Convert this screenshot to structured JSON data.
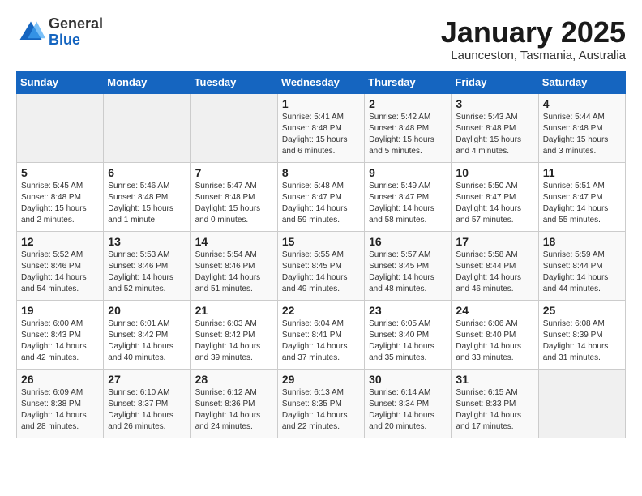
{
  "header": {
    "logo_general": "General",
    "logo_blue": "Blue",
    "month": "January 2025",
    "location": "Launceston, Tasmania, Australia"
  },
  "weekdays": [
    "Sunday",
    "Monday",
    "Tuesday",
    "Wednesday",
    "Thursday",
    "Friday",
    "Saturday"
  ],
  "weeks": [
    [
      {
        "day": "",
        "sunrise": "",
        "sunset": "",
        "daylight": ""
      },
      {
        "day": "",
        "sunrise": "",
        "sunset": "",
        "daylight": ""
      },
      {
        "day": "",
        "sunrise": "",
        "sunset": "",
        "daylight": ""
      },
      {
        "day": "1",
        "sunrise": "Sunrise: 5:41 AM",
        "sunset": "Sunset: 8:48 PM",
        "daylight": "Daylight: 15 hours and 6 minutes."
      },
      {
        "day": "2",
        "sunrise": "Sunrise: 5:42 AM",
        "sunset": "Sunset: 8:48 PM",
        "daylight": "Daylight: 15 hours and 5 minutes."
      },
      {
        "day": "3",
        "sunrise": "Sunrise: 5:43 AM",
        "sunset": "Sunset: 8:48 PM",
        "daylight": "Daylight: 15 hours and 4 minutes."
      },
      {
        "day": "4",
        "sunrise": "Sunrise: 5:44 AM",
        "sunset": "Sunset: 8:48 PM",
        "daylight": "Daylight: 15 hours and 3 minutes."
      }
    ],
    [
      {
        "day": "5",
        "sunrise": "Sunrise: 5:45 AM",
        "sunset": "Sunset: 8:48 PM",
        "daylight": "Daylight: 15 hours and 2 minutes."
      },
      {
        "day": "6",
        "sunrise": "Sunrise: 5:46 AM",
        "sunset": "Sunset: 8:48 PM",
        "daylight": "Daylight: 15 hours and 1 minute."
      },
      {
        "day": "7",
        "sunrise": "Sunrise: 5:47 AM",
        "sunset": "Sunset: 8:48 PM",
        "daylight": "Daylight: 15 hours and 0 minutes."
      },
      {
        "day": "8",
        "sunrise": "Sunrise: 5:48 AM",
        "sunset": "Sunset: 8:47 PM",
        "daylight": "Daylight: 14 hours and 59 minutes."
      },
      {
        "day": "9",
        "sunrise": "Sunrise: 5:49 AM",
        "sunset": "Sunset: 8:47 PM",
        "daylight": "Daylight: 14 hours and 58 minutes."
      },
      {
        "day": "10",
        "sunrise": "Sunrise: 5:50 AM",
        "sunset": "Sunset: 8:47 PM",
        "daylight": "Daylight: 14 hours and 57 minutes."
      },
      {
        "day": "11",
        "sunrise": "Sunrise: 5:51 AM",
        "sunset": "Sunset: 8:47 PM",
        "daylight": "Daylight: 14 hours and 55 minutes."
      }
    ],
    [
      {
        "day": "12",
        "sunrise": "Sunrise: 5:52 AM",
        "sunset": "Sunset: 8:46 PM",
        "daylight": "Daylight: 14 hours and 54 minutes."
      },
      {
        "day": "13",
        "sunrise": "Sunrise: 5:53 AM",
        "sunset": "Sunset: 8:46 PM",
        "daylight": "Daylight: 14 hours and 52 minutes."
      },
      {
        "day": "14",
        "sunrise": "Sunrise: 5:54 AM",
        "sunset": "Sunset: 8:46 PM",
        "daylight": "Daylight: 14 hours and 51 minutes."
      },
      {
        "day": "15",
        "sunrise": "Sunrise: 5:55 AM",
        "sunset": "Sunset: 8:45 PM",
        "daylight": "Daylight: 14 hours and 49 minutes."
      },
      {
        "day": "16",
        "sunrise": "Sunrise: 5:57 AM",
        "sunset": "Sunset: 8:45 PM",
        "daylight": "Daylight: 14 hours and 48 minutes."
      },
      {
        "day": "17",
        "sunrise": "Sunrise: 5:58 AM",
        "sunset": "Sunset: 8:44 PM",
        "daylight": "Daylight: 14 hours and 46 minutes."
      },
      {
        "day": "18",
        "sunrise": "Sunrise: 5:59 AM",
        "sunset": "Sunset: 8:44 PM",
        "daylight": "Daylight: 14 hours and 44 minutes."
      }
    ],
    [
      {
        "day": "19",
        "sunrise": "Sunrise: 6:00 AM",
        "sunset": "Sunset: 8:43 PM",
        "daylight": "Daylight: 14 hours and 42 minutes."
      },
      {
        "day": "20",
        "sunrise": "Sunrise: 6:01 AM",
        "sunset": "Sunset: 8:42 PM",
        "daylight": "Daylight: 14 hours and 40 minutes."
      },
      {
        "day": "21",
        "sunrise": "Sunrise: 6:03 AM",
        "sunset": "Sunset: 8:42 PM",
        "daylight": "Daylight: 14 hours and 39 minutes."
      },
      {
        "day": "22",
        "sunrise": "Sunrise: 6:04 AM",
        "sunset": "Sunset: 8:41 PM",
        "daylight": "Daylight: 14 hours and 37 minutes."
      },
      {
        "day": "23",
        "sunrise": "Sunrise: 6:05 AM",
        "sunset": "Sunset: 8:40 PM",
        "daylight": "Daylight: 14 hours and 35 minutes."
      },
      {
        "day": "24",
        "sunrise": "Sunrise: 6:06 AM",
        "sunset": "Sunset: 8:40 PM",
        "daylight": "Daylight: 14 hours and 33 minutes."
      },
      {
        "day": "25",
        "sunrise": "Sunrise: 6:08 AM",
        "sunset": "Sunset: 8:39 PM",
        "daylight": "Daylight: 14 hours and 31 minutes."
      }
    ],
    [
      {
        "day": "26",
        "sunrise": "Sunrise: 6:09 AM",
        "sunset": "Sunset: 8:38 PM",
        "daylight": "Daylight: 14 hours and 28 minutes."
      },
      {
        "day": "27",
        "sunrise": "Sunrise: 6:10 AM",
        "sunset": "Sunset: 8:37 PM",
        "daylight": "Daylight: 14 hours and 26 minutes."
      },
      {
        "day": "28",
        "sunrise": "Sunrise: 6:12 AM",
        "sunset": "Sunset: 8:36 PM",
        "daylight": "Daylight: 14 hours and 24 minutes."
      },
      {
        "day": "29",
        "sunrise": "Sunrise: 6:13 AM",
        "sunset": "Sunset: 8:35 PM",
        "daylight": "Daylight: 14 hours and 22 minutes."
      },
      {
        "day": "30",
        "sunrise": "Sunrise: 6:14 AM",
        "sunset": "Sunset: 8:34 PM",
        "daylight": "Daylight: 14 hours and 20 minutes."
      },
      {
        "day": "31",
        "sunrise": "Sunrise: 6:15 AM",
        "sunset": "Sunset: 8:33 PM",
        "daylight": "Daylight: 14 hours and 17 minutes."
      },
      {
        "day": "",
        "sunrise": "",
        "sunset": "",
        "daylight": ""
      }
    ]
  ]
}
